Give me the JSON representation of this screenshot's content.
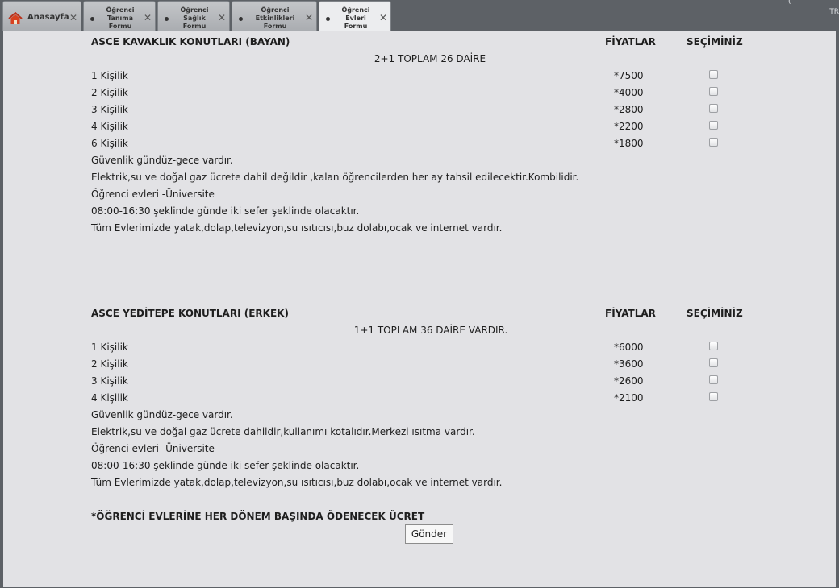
{
  "topbar": {
    "corner_text": "TR",
    "corner_mark": "("
  },
  "tabs": [
    {
      "label": "Anasayfa"
    },
    {
      "label": "Öğrenci Tanıma Formu"
    },
    {
      "label": "Öğrenci Sağlık Formu"
    },
    {
      "label": "Öğrenci Etkinlikleri Formu"
    },
    {
      "label": "Öğrenci Evleri Formu"
    }
  ],
  "section1": {
    "title": "ASCE KAVAKLIK KONUTLARI (BAYAN)",
    "prices_header": "FİYATLAR",
    "choice_header": "SEÇİMİNİZ",
    "subtitle": "2+1 TOPLAM 26 DAİRE",
    "rows": [
      {
        "label": "1 Kişilik",
        "price": "*7500"
      },
      {
        "label": "2 Kişilik",
        "price": "*4000"
      },
      {
        "label": "3 Kişilik",
        "price": "*2800"
      },
      {
        "label": "4 Kişilik",
        "price": "*2200"
      },
      {
        "label": "6 Kişilik",
        "price": "*1800"
      }
    ],
    "notes": [
      "Güvenlik gündüz-gece  vardır.",
      "Elektrik,su ve doğal gaz ücrete dahil değildir ,kalan öğrencilerden her ay tahsil edilecektir.Kombilidir.",
      "Öğrenci evleri -Üniversite",
      "08:00-16:30 şeklinde günde iki sefer şeklinde olacaktır.",
      "Tüm Evlerimizde yatak,dolap,televizyon,su ısıtıcısı,buz dolabı,ocak ve internet vardır."
    ]
  },
  "section2": {
    "title": "ASCE YEDİTEPE KONUTLARI (ERKEK)",
    "prices_header": "FİYATLAR",
    "choice_header": "SEÇİMİNİZ",
    "subtitle": "1+1 TOPLAM 36 DAİRE VARDIR.",
    "rows": [
      {
        "label": "1 Kişilik",
        "price": "*6000"
      },
      {
        "label": "2 Kişilik",
        "price": "*3600"
      },
      {
        "label": "3 Kişilik",
        "price": "*2600"
      },
      {
        "label": "4 Kişilik",
        "price": "*2100"
      }
    ],
    "notes": [
      "Güvenlik gündüz-gece  vardır.",
      "Elektrik,su ve doğal gaz ücrete dahildir,kullanımı kotalıdır.Merkezi ısıtma vardır.",
      "Öğrenci evleri -Üniversite",
      "08:00-16:30 şeklinde günde iki sefer şeklinde olacaktır.",
      "Tüm Evlerimizde yatak,dolap,televizyon,su ısıtıcısı,buz dolabı,ocak ve internet vardır."
    ]
  },
  "footer_note": "*ÖĞRENCİ EVLERİNE HER DÖNEM BAŞINDA ÖDENECEK ÜCRET",
  "submit_label": "Gönder"
}
